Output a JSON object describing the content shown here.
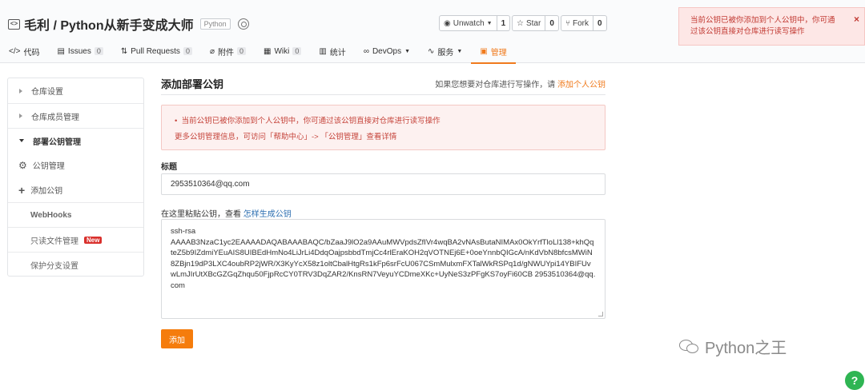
{
  "header": {
    "owner": "毛利",
    "separator": "/",
    "repo": "Python从新手变成大师",
    "lang_tag": "Python",
    "watch": {
      "label": "Unwatch",
      "count": "1"
    },
    "star": {
      "label": "Star",
      "count": "0"
    },
    "fork": {
      "label": "Fork",
      "count": "0"
    }
  },
  "toast": {
    "message": "当前公钥已被你添加到个人公钥中，你可通过该公钥直接对仓库进行读写操作",
    "close": "×"
  },
  "nav": [
    {
      "icon": "code-icon",
      "label": "代码"
    },
    {
      "icon": "issues-icon",
      "label": "Issues",
      "count": "0"
    },
    {
      "icon": "pull-request-icon",
      "label": "Pull Requests",
      "count": "0"
    },
    {
      "icon": "attachment-icon",
      "label": "附件",
      "count": "0"
    },
    {
      "icon": "wiki-icon",
      "label": "Wiki",
      "count": "0"
    },
    {
      "icon": "stats-icon",
      "label": "统计"
    },
    {
      "icon": "devops-icon",
      "label": "DevOps"
    },
    {
      "icon": "service-icon",
      "label": "服务"
    },
    {
      "icon": "manage-icon",
      "label": "管理"
    }
  ],
  "sidebar": {
    "repo_settings": "仓库设置",
    "members": "仓库成员管理",
    "deploy_keys": "部署公钥管理",
    "key_manage": "公钥管理",
    "add_key": "添加公钥",
    "webhooks": "WebHooks",
    "readonly_files": "只读文件管理",
    "new_badge": "New",
    "protected_branches": "保护分支设置"
  },
  "main": {
    "title": "添加部署公钥",
    "hint_prefix": "如果您想要对仓库进行写操作，请",
    "hint_link": "添加个人公钥",
    "notice_line1": "当前公钥已被你添加到个人公钥中，你可通过该公钥直接对仓库进行读写操作",
    "notice_line2": "更多公钥管理信息，可访问「帮助中心」-> 「公钥管理」查看详情",
    "title_label": "标题",
    "title_value": "2953510364@qq.com",
    "paste_prefix": "在这里粘贴公钥，查看",
    "paste_link": "怎样生成公钥",
    "key_value": "ssh-rsa\nAAAAB3NzaC1yc2EAAAADAQABAAABAQC/bZaaJ9lO2a9AAuMWVpdsZfIVr4wqBA2vNAsButaNIMAx0OkYrfTloLl138+khQqteZ5b9IZdmiYEuAIS8UIBEdHmNo4LiJrLi4DdqOajpsbbdTmjCc4rlEraKOH2qVOTNEj6E+0oeYnnbQIGcA/nKdVbN8bfcsMWiN8ZBjn19dP3LXC4oubRP2jWR/X3KyYcX58z1oltCbalHtgRs1kFp6srFcU067CSmMulxmFXTalWkRSPq1d/gNWUYpi14YBIFUvwLmJIrUtXBcGZGqZhqu50FjpRcCY0TRV3DqZAR2/KnsRN7VeyuYCDmeXKc+UyNeS3zPFgKS7oyFi60CB 2953510364@qq.com",
    "submit": "添加"
  },
  "watermark": "Python之王",
  "help_fab": "?"
}
